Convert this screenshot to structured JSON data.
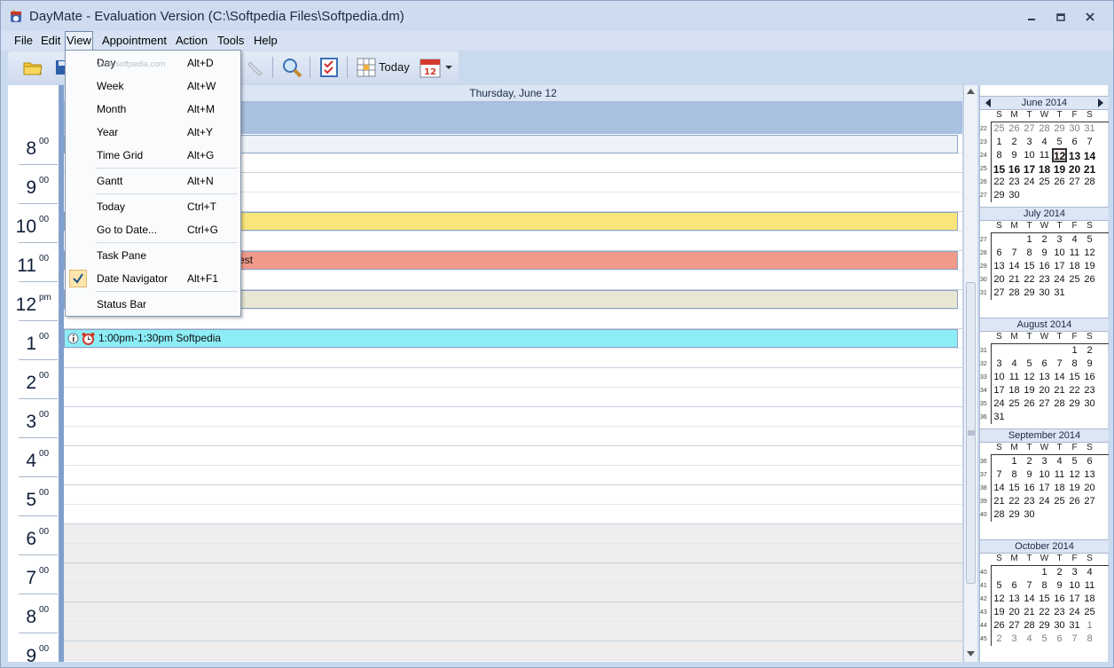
{
  "window": {
    "title": "DayMate - Evaluation Version (C:\\Softpedia Files\\Softpedia.dm)"
  },
  "menubar": [
    "File",
    "Edit",
    "View",
    "Appointment",
    "Action",
    "Tools",
    "Help"
  ],
  "toolbar": {
    "today_label": "Today"
  },
  "watermark": "www.softpedia.com",
  "view_menu": {
    "items": [
      {
        "label": "Day",
        "shortcut": "Alt+D"
      },
      {
        "label": "Week",
        "shortcut": "Alt+W"
      },
      {
        "label": "Month",
        "shortcut": "Alt+M"
      },
      {
        "label": "Year",
        "shortcut": "Alt+Y"
      },
      {
        "label": "Time Grid",
        "shortcut": "Alt+G"
      },
      {
        "label": "Gantt",
        "shortcut": "Alt+N"
      },
      {
        "label": "Today",
        "shortcut": "Ctrl+T"
      },
      {
        "label": "Go to Date...",
        "shortcut": "Ctrl+G"
      },
      {
        "label": "Task Pane",
        "shortcut": ""
      },
      {
        "label": "Date Navigator",
        "shortcut": "Alt+F1"
      },
      {
        "label": "Status Bar",
        "shortcut": ""
      }
    ]
  },
  "day_view": {
    "header": "Thursday, June 12",
    "hours": [
      {
        "n": "8",
        "s": "00"
      },
      {
        "n": "9",
        "s": "00"
      },
      {
        "n": "10",
        "s": "00"
      },
      {
        "n": "11",
        "s": "00"
      },
      {
        "n": "12",
        "s": "pm"
      },
      {
        "n": "1",
        "s": "00"
      },
      {
        "n": "2",
        "s": "00"
      },
      {
        "n": "3",
        "s": "00"
      },
      {
        "n": "4",
        "s": "00"
      },
      {
        "n": "5",
        "s": "00"
      },
      {
        "n": "6",
        "s": "00"
      },
      {
        "n": "7",
        "s": "00"
      },
      {
        "n": "8",
        "s": "00"
      },
      {
        "n": "9",
        "s": "00"
      }
    ],
    "appointments": [
      {
        "text": "",
        "color": "#eef3fa"
      },
      {
        "text": "",
        "color": "#f9e57a"
      },
      {
        "text": "est",
        "color": "#f29a8a"
      },
      {
        "text": "",
        "color": "#e7e7d3"
      },
      {
        "text": "1:00pm-1:30pm Softpedia",
        "color": "#8cedf7"
      }
    ]
  },
  "navigator": {
    "days": [
      "S",
      "M",
      "T",
      "W",
      "T",
      "F",
      "S"
    ],
    "months": [
      {
        "title": "June 2014",
        "weeks": [
          {
            "wk": "22",
            "d": [
              "25",
              "26",
              "27",
              "28",
              "29",
              "30",
              "31"
            ]
          },
          {
            "wk": "23",
            "d": [
              "1",
              "2",
              "3",
              "4",
              "5",
              "6",
              "7"
            ]
          },
          {
            "wk": "24",
            "d": [
              "8",
              "9",
              "10",
              "11",
              "12",
              "13",
              "14"
            ]
          },
          {
            "wk": "25",
            "d": [
              "15",
              "16",
              "17",
              "18",
              "19",
              "20",
              "21"
            ]
          },
          {
            "wk": "26",
            "d": [
              "22",
              "23",
              "24",
              "25",
              "26",
              "27",
              "28"
            ]
          },
          {
            "wk": "27",
            "d": [
              "29",
              "30",
              "",
              "",
              "",
              "",
              ""
            ]
          }
        ]
      },
      {
        "title": "July 2014",
        "weeks": [
          {
            "wk": "27",
            "d": [
              "",
              "",
              "1",
              "2",
              "3",
              "4",
              "5"
            ]
          },
          {
            "wk": "28",
            "d": [
              "6",
              "7",
              "8",
              "9",
              "10",
              "11",
              "12"
            ]
          },
          {
            "wk": "29",
            "d": [
              "13",
              "14",
              "15",
              "16",
              "17",
              "18",
              "19"
            ]
          },
          {
            "wk": "30",
            "d": [
              "20",
              "21",
              "22",
              "23",
              "24",
              "25",
              "26"
            ]
          },
          {
            "wk": "31",
            "d": [
              "27",
              "28",
              "29",
              "30",
              "31",
              "",
              ""
            ]
          }
        ]
      },
      {
        "title": "August 2014",
        "weeks": [
          {
            "wk": "31",
            "d": [
              "",
              "",
              "",
              "",
              "",
              "1",
              "2"
            ]
          },
          {
            "wk": "32",
            "d": [
              "3",
              "4",
              "5",
              "6",
              "7",
              "8",
              "9"
            ]
          },
          {
            "wk": "33",
            "d": [
              "10",
              "11",
              "12",
              "13",
              "14",
              "15",
              "16"
            ]
          },
          {
            "wk": "34",
            "d": [
              "17",
              "18",
              "19",
              "20",
              "21",
              "22",
              "23"
            ]
          },
          {
            "wk": "35",
            "d": [
              "24",
              "25",
              "26",
              "27",
              "28",
              "29",
              "30"
            ]
          },
          {
            "wk": "36",
            "d": [
              "31",
              "",
              "",
              "",
              "",
              "",
              ""
            ]
          }
        ]
      },
      {
        "title": "September 2014",
        "weeks": [
          {
            "wk": "36",
            "d": [
              "",
              "1",
              "2",
              "3",
              "4",
              "5",
              "6"
            ]
          },
          {
            "wk": "37",
            "d": [
              "7",
              "8",
              "9",
              "10",
              "11",
              "12",
              "13"
            ]
          },
          {
            "wk": "38",
            "d": [
              "14",
              "15",
              "16",
              "17",
              "18",
              "19",
              "20"
            ]
          },
          {
            "wk": "39",
            "d": [
              "21",
              "22",
              "23",
              "24",
              "25",
              "26",
              "27"
            ]
          },
          {
            "wk": "40",
            "d": [
              "28",
              "29",
              "30",
              "",
              "",
              "",
              ""
            ]
          }
        ]
      },
      {
        "title": "October 2014",
        "weeks": [
          {
            "wk": "40",
            "d": [
              "",
              "",
              "",
              "1",
              "2",
              "3",
              "4"
            ]
          },
          {
            "wk": "41",
            "d": [
              "5",
              "6",
              "7",
              "8",
              "9",
              "10",
              "11"
            ]
          },
          {
            "wk": "42",
            "d": [
              "12",
              "13",
              "14",
              "15",
              "16",
              "17",
              "18"
            ]
          },
          {
            "wk": "43",
            "d": [
              "19",
              "20",
              "21",
              "22",
              "23",
              "24",
              "25"
            ]
          },
          {
            "wk": "44",
            "d": [
              "26",
              "27",
              "28",
              "29",
              "30",
              "31",
              "1"
            ]
          },
          {
            "wk": "45",
            "d": [
              "2",
              "3",
              "4",
              "5",
              "6",
              "7",
              "8"
            ]
          }
        ]
      }
    ]
  },
  "colors": {
    "accent": "#7fa0cc",
    "allday": "#a9c0e0",
    "menu_check": "#fde6ad"
  }
}
